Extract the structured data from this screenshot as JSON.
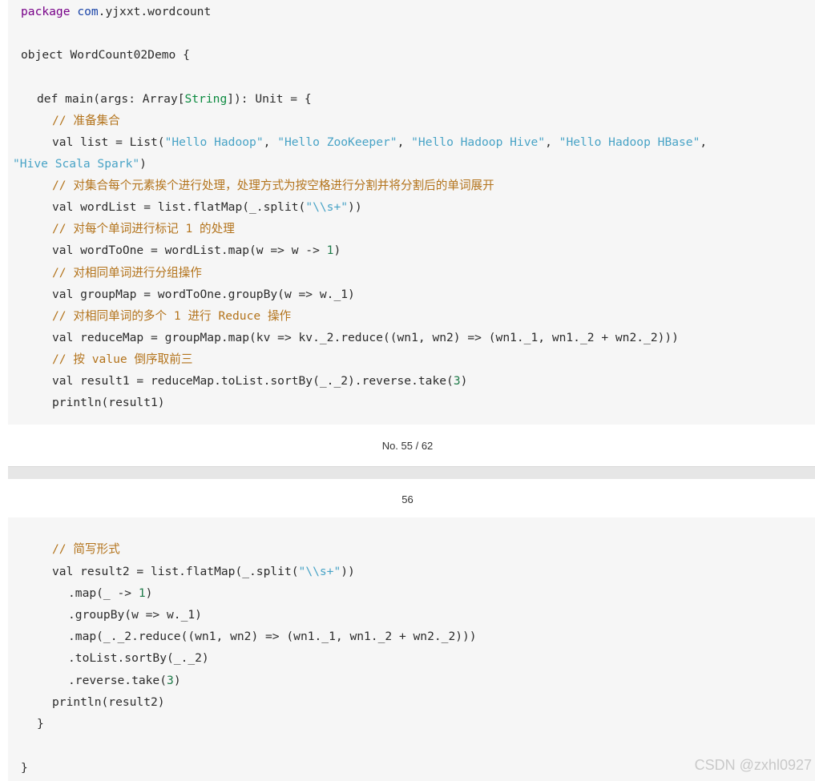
{
  "page1": {
    "code": {
      "package_kw": "package",
      "package_name": "com",
      "package_rest": ".yjxxt.wordcount",
      "object_kw": "object",
      "object_rest": " WordCount02Demo {",
      "main_def": "def",
      "main_rest1": " main(args: Array[",
      "main_type": "String",
      "main_rest2": "]): Unit = {",
      "comment1": "// 准备集合",
      "val_list_prefix": "val list = List(",
      "list_items": [
        "\"Hello Hadoop\"",
        "\"Hello ZooKeeper\"",
        "\"Hello Hadoop Hive\"",
        "\"Hello Hadoop HBase\""
      ],
      "list_sep": ", ",
      "list_wrap_item": "\"Hive Scala Spark\"",
      "list_wrap_close": ")",
      "comment2": "// 对集合每个元素挨个进行处理，处理方式为按空格进行分割并将分割后的单词展开",
      "wordlist_prefix": "val wordList = list.flatMap(_.split(",
      "wordlist_regex": "\"\\\\s+\"",
      "wordlist_suffix": "))",
      "comment3": "// 对每个单词进行标记 1 的处理",
      "wordtoone_prefix": "val wordToOne = wordList.map(w => w -> ",
      "wordtoone_num": "1",
      "wordtoone_suffix": ")",
      "comment4": "// 对相同单词进行分组操作",
      "groupmap": "val groupMap = wordToOne.groupBy(w => w._1)",
      "comment5": "// 对相同单词的多个 1 进行 Reduce 操作",
      "reducemap": "val reduceMap = groupMap.map(kv => kv._2.reduce((wn1, wn2) => (wn1._1, wn1._2 + wn2._2)))",
      "comment6": "// 按 value 倒序取前三",
      "result1_prefix": "val result1 = reduceMap.toList.sortBy(_._2).reverse.take(",
      "result1_num": "3",
      "result1_suffix": ")",
      "println1": "println(result1)"
    },
    "footer": "No. 55 / 62"
  },
  "page2": {
    "page_number": "56",
    "code": {
      "comment": "// 简写形式",
      "result2_prefix": "val result2 = list.flatMap(_.split(",
      "result2_regex": "\"\\\\s+\"",
      "result2_suffix": "))",
      "map1_prefix": ".map(_ -> ",
      "map1_num": "1",
      "map1_suffix": ")",
      "groupby": ".groupBy(w => w._1)",
      "map2": ".map(_._2.reduce((wn1, wn2) => (wn1._1, wn1._2 + wn2._2)))",
      "sortby": ".toList.sortBy(_._2)",
      "take_prefix": ".reverse.take(",
      "take_num": "3",
      "take_suffix": ")",
      "println2": "println(result2)",
      "close_main": "}",
      "close_object": "}"
    }
  },
  "watermark": "CSDN @zxhl0927"
}
